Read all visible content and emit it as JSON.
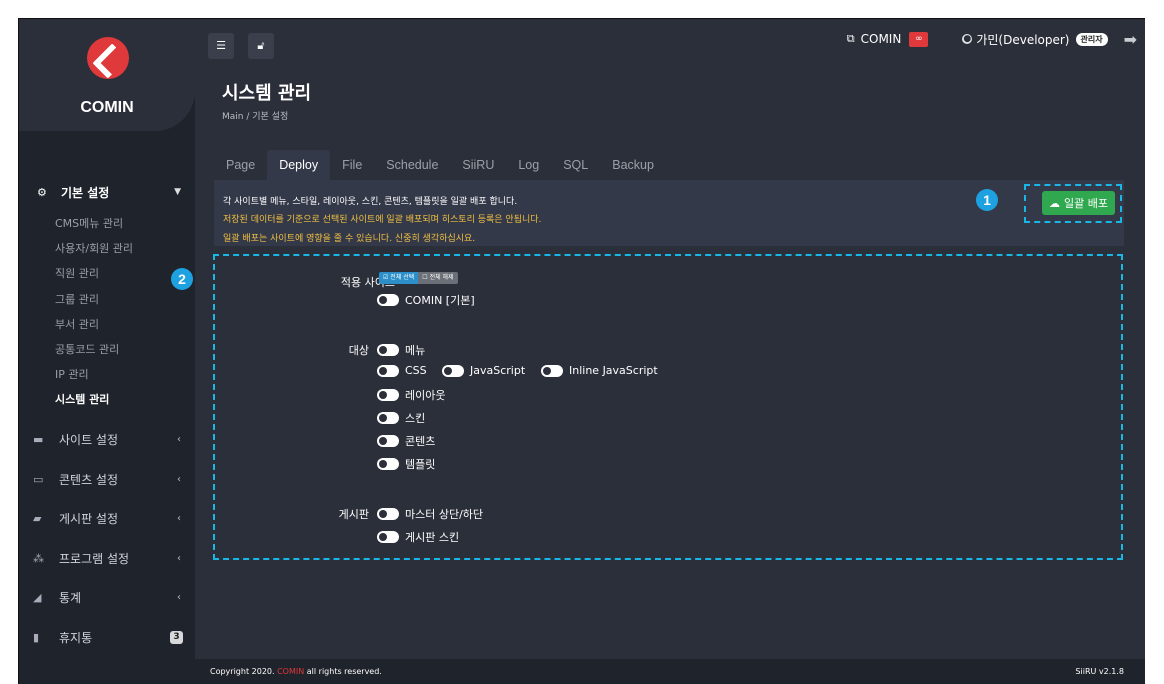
{
  "brand": {
    "name": "COMIN"
  },
  "sidebar": {
    "section": {
      "label": "기본 설정",
      "icon": "gears-icon"
    },
    "items": [
      {
        "label": "CMS메뉴 관리"
      },
      {
        "label": "사용자/회원 관리"
      },
      {
        "label": "직원 관리"
      },
      {
        "label": "그룹 관리"
      },
      {
        "label": "부서 관리"
      },
      {
        "label": "공통코드 관리"
      },
      {
        "label": "IP 관리"
      },
      {
        "label": "시스템 관리"
      }
    ],
    "groups": [
      {
        "label": "사이트 설정"
      },
      {
        "label": "콘텐츠 설정"
      },
      {
        "label": "게시판 설정"
      },
      {
        "label": "프로그램 설정"
      },
      {
        "label": "통계"
      },
      {
        "label": "휴지통",
        "count": "3"
      }
    ]
  },
  "topbar": {
    "site": "COMIN",
    "user": "가민(Developer)",
    "role": "관리자"
  },
  "page": {
    "title": "시스템 관리",
    "breadcrumb": "Main  /  기본 설정"
  },
  "tabs": [
    "Page",
    "Deploy",
    "File",
    "Schedule",
    "SiiRU",
    "Log",
    "SQL",
    "Backup"
  ],
  "notice": {
    "line1": "각 사이트별 메뉴, 스타일, 레이아웃, 스킨, 콘텐츠, 템플릿을 일괄 배포 합니다.",
    "line2": "저장된 데이터를 기준으로 선택된 사이트에 일괄 배포되며 히스토리 등록은 안됩니다.",
    "line3": "일괄 배포는 사이트에 영향을 줄 수 있습니다. 신중히 생각하십시요."
  },
  "deploy_button": "일괄 배포",
  "callouts": {
    "one": "1",
    "two": "2"
  },
  "form": {
    "site_label": "적용 사이트",
    "select_all": "전체 선택",
    "deselect_all": "전체 해제",
    "site_option": "COMIN [기본]",
    "target_label": "대상",
    "targets": {
      "menu": "메뉴",
      "css": "CSS",
      "js": "JavaScript",
      "inline_js": "Inline JavaScript",
      "layout": "레이아웃",
      "skin": "스킨",
      "contents": "콘텐츠",
      "template": "템플릿"
    },
    "board_label": "게시판",
    "board": {
      "master": "마스터 상단/하단",
      "skin": "게시판 스킨"
    }
  },
  "footer": {
    "copy_prefix": "Copyright 2020. ",
    "copy_brand": "COMIN",
    "copy_suffix": " all rights reserved.",
    "version": "SiiRU v2.1.8"
  },
  "colors": {
    "accent": "#19b7e6",
    "brand": "#e0393b",
    "deploy": "#2fa84f",
    "warning": "#f0c040"
  }
}
